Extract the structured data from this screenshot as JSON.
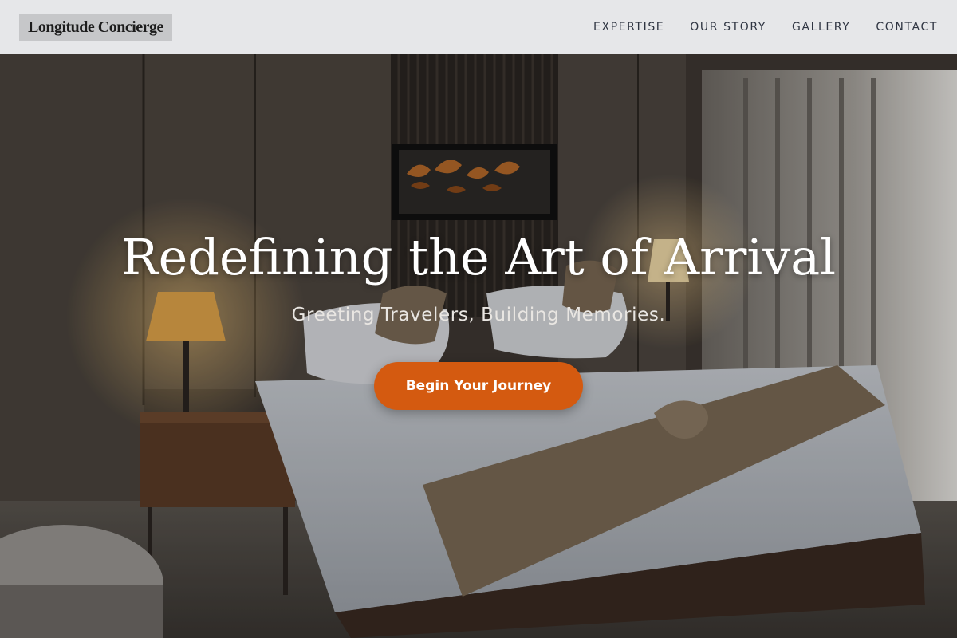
{
  "header": {
    "logo": "Longitude Concierge",
    "nav": [
      {
        "label": "EXPERTISE"
      },
      {
        "label": "OUR STORY"
      },
      {
        "label": "GALLERY"
      },
      {
        "label": "CONTACT"
      }
    ]
  },
  "hero": {
    "background": "hotel-bedroom-photo",
    "title": "Redefining the Art of Arrival",
    "subtitle": "Greeting Travelers, Building Memories.",
    "cta_label": "Begin Your Journey",
    "colors": {
      "cta": "#d45a10",
      "title": "#ffffff",
      "header_bg": "#e6e7e9"
    }
  }
}
